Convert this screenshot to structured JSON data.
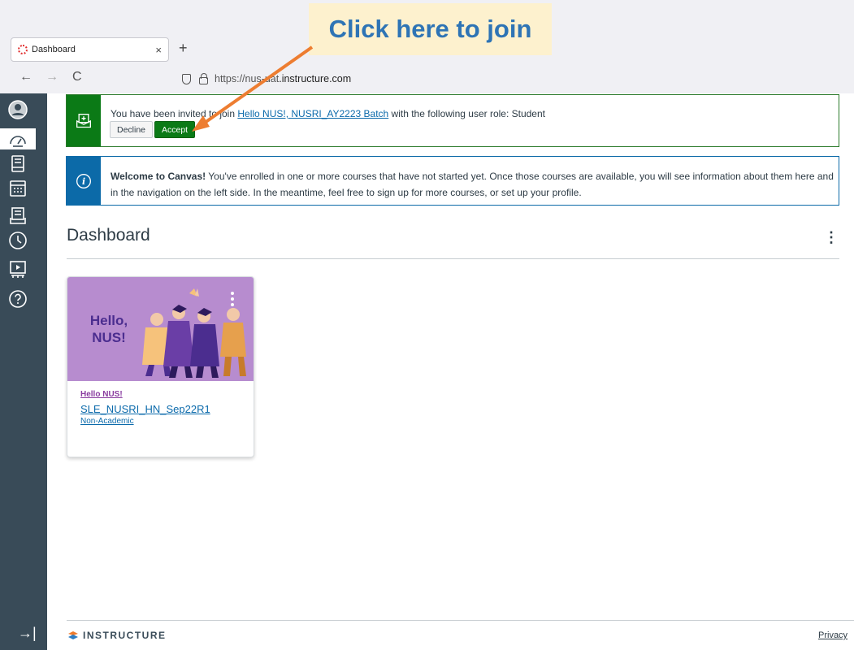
{
  "browser": {
    "tab_title": "Dashboard",
    "tab_close": "×",
    "new_tab": "+",
    "back": "←",
    "forward": "→",
    "reload": "C",
    "url_prefix": "https://",
    "url_fragment": "nus-uat",
    "url_domain": ".instructure.com"
  },
  "callout": {
    "text": "Click here to join",
    "color": "#2e74b5",
    "arrow_color": "#ed7d31"
  },
  "sidebar": {
    "items": [
      "account-icon",
      "dashboard-icon",
      "courses-icon",
      "calendar-icon",
      "inbox-icon",
      "history-icon",
      "studio-icon",
      "help-icon"
    ],
    "collapse": "→|"
  },
  "invite": {
    "text_before": "You have been invited to join ",
    "course_link": "Hello NUS!, NUSRI_AY2223 Batch",
    "text_after": " with the following user role: Student",
    "decline_label": "Decline",
    "accept_label": "Accept"
  },
  "welcome": {
    "bold": "Welcome to Canvas!",
    "text": "  You've enrolled in one or more courses that have not started yet. Once those courses are available, you will see information about them here and in the navigation on the left side. In the meantime, feel free to sign up for more courses, or set up your profile."
  },
  "dashboard": {
    "title": "Dashboard",
    "options": "⋮"
  },
  "course_card": {
    "hero_text": "Hello, NUS!",
    "subtitle": "Hello NUS!",
    "name": "SLE_NUSRI_HN_Sep22R1",
    "term": "Non-Academic"
  },
  "footer": {
    "logo": "INSTRUCTURE",
    "privacy": "Privacy"
  },
  "colors": {
    "sidebar": "#394b58",
    "success": "#0b7a16",
    "info": "#0c6aa8",
    "link": "#0b6aab"
  }
}
